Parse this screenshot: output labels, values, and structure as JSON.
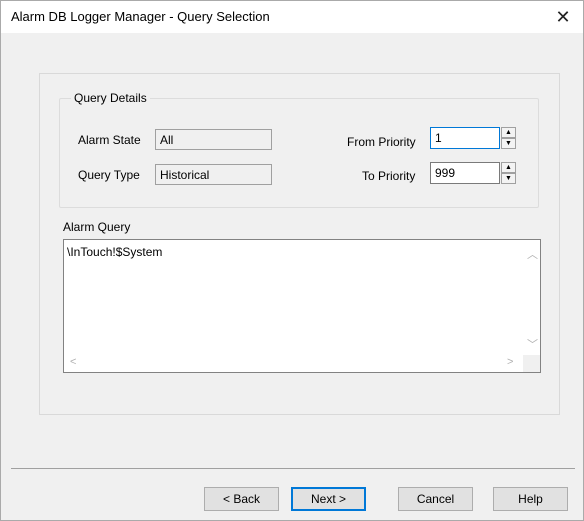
{
  "window": {
    "title": "Alarm DB Logger Manager - Query Selection",
    "close_symbol": "✕"
  },
  "query_details": {
    "legend": "Query Details",
    "alarm_state_label": "Alarm State",
    "alarm_state_value": "All",
    "query_type_label": "Query Type",
    "query_type_value": "Historical",
    "from_priority_label": "From Priority",
    "from_priority_value": "1",
    "to_priority_label": "To Priority",
    "to_priority_value": "999"
  },
  "alarm_query": {
    "label": "Alarm Query",
    "text": "\\InTouch!$System"
  },
  "buttons": {
    "back": "< Back",
    "next": "Next >",
    "cancel": "Cancel",
    "help": "Help"
  },
  "icons": {
    "spin_up": "triangle-up-icon",
    "spin_down": "triangle-down-icon"
  }
}
